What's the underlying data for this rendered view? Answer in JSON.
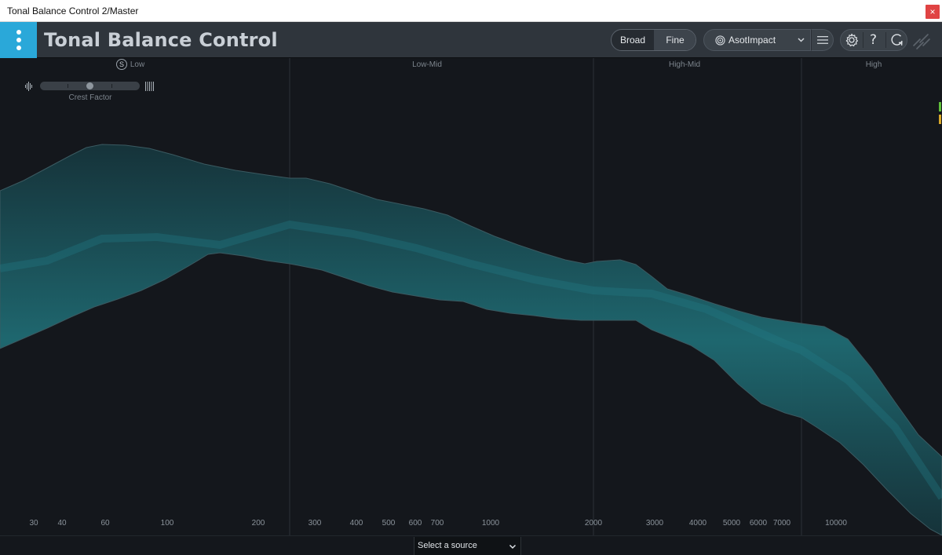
{
  "window": {
    "title": "Tonal Balance Control 2/Master",
    "close_glyph": "×"
  },
  "header": {
    "app_title": "Tonal Balance Control",
    "view_modes": {
      "broad": "Broad",
      "fine": "Fine",
      "selected": "Fine"
    },
    "preset": {
      "name": "AsotImpact",
      "icon": "target-icon"
    },
    "icons": [
      "menu-icon",
      "gear-icon",
      "help-icon",
      "undo-icon",
      "link-icon"
    ],
    "help_glyph": "?",
    "accent_color": "#2aa8d9"
  },
  "bands": {
    "low": "Low",
    "low_mid": "Low-Mid",
    "high_mid": "High-Mid",
    "high": "High",
    "solo_glyph": "S"
  },
  "crest_factor": {
    "label": "Crest Factor",
    "level": 0.5
  },
  "frequency_axis": [
    "30",
    "40",
    "60",
    "100",
    "200",
    "300",
    "400",
    "500",
    "600",
    "700",
    "1000",
    "2000",
    "3000",
    "4000",
    "5000",
    "6000",
    "7000",
    "10000"
  ],
  "target_band": {
    "color": "#1f6b73"
  },
  "footer": {
    "source_select": "Select a source"
  }
}
